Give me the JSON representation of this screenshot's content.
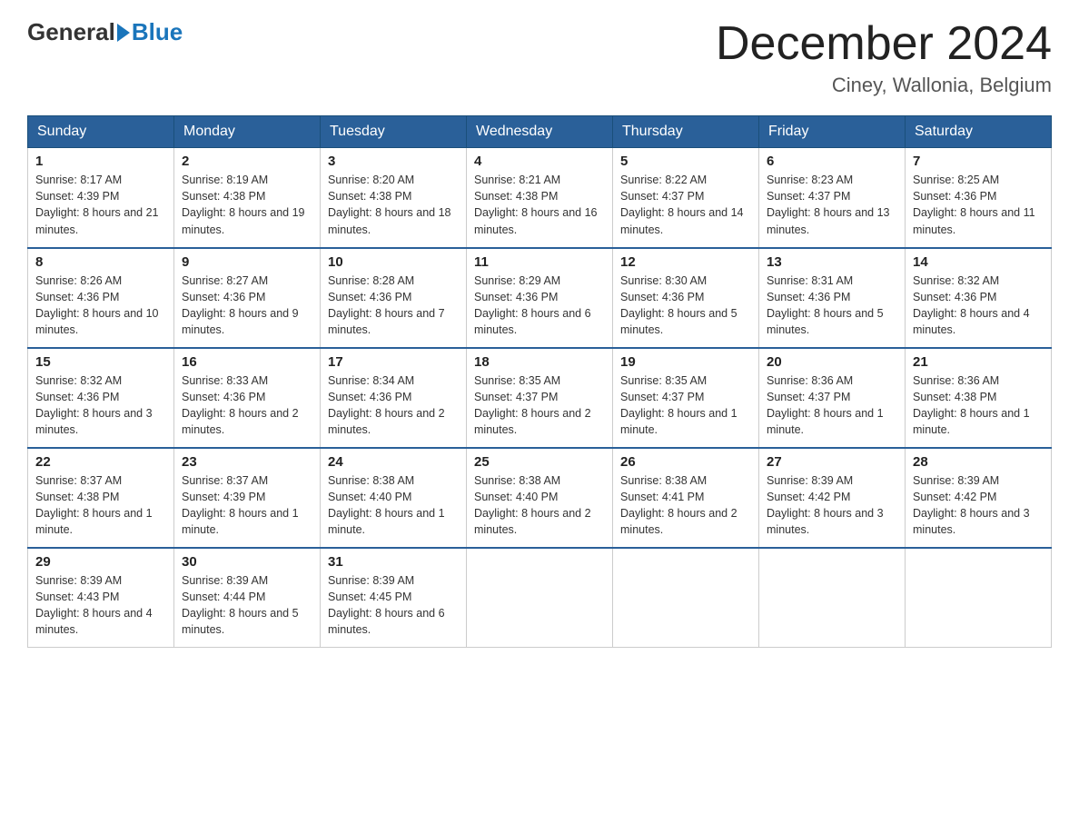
{
  "header": {
    "logo_general": "General",
    "logo_blue": "Blue",
    "month_title": "December 2024",
    "location": "Ciney, Wallonia, Belgium"
  },
  "weekdays": [
    "Sunday",
    "Monday",
    "Tuesday",
    "Wednesday",
    "Thursday",
    "Friday",
    "Saturday"
  ],
  "weeks": [
    [
      {
        "day": "1",
        "sunrise": "8:17 AM",
        "sunset": "4:39 PM",
        "daylight": "8 hours and 21 minutes."
      },
      {
        "day": "2",
        "sunrise": "8:19 AM",
        "sunset": "4:38 PM",
        "daylight": "8 hours and 19 minutes."
      },
      {
        "day": "3",
        "sunrise": "8:20 AM",
        "sunset": "4:38 PM",
        "daylight": "8 hours and 18 minutes."
      },
      {
        "day": "4",
        "sunrise": "8:21 AM",
        "sunset": "4:38 PM",
        "daylight": "8 hours and 16 minutes."
      },
      {
        "day": "5",
        "sunrise": "8:22 AM",
        "sunset": "4:37 PM",
        "daylight": "8 hours and 14 minutes."
      },
      {
        "day": "6",
        "sunrise": "8:23 AM",
        "sunset": "4:37 PM",
        "daylight": "8 hours and 13 minutes."
      },
      {
        "day": "7",
        "sunrise": "8:25 AM",
        "sunset": "4:36 PM",
        "daylight": "8 hours and 11 minutes."
      }
    ],
    [
      {
        "day": "8",
        "sunrise": "8:26 AM",
        "sunset": "4:36 PM",
        "daylight": "8 hours and 10 minutes."
      },
      {
        "day": "9",
        "sunrise": "8:27 AM",
        "sunset": "4:36 PM",
        "daylight": "8 hours and 9 minutes."
      },
      {
        "day": "10",
        "sunrise": "8:28 AM",
        "sunset": "4:36 PM",
        "daylight": "8 hours and 7 minutes."
      },
      {
        "day": "11",
        "sunrise": "8:29 AM",
        "sunset": "4:36 PM",
        "daylight": "8 hours and 6 minutes."
      },
      {
        "day": "12",
        "sunrise": "8:30 AM",
        "sunset": "4:36 PM",
        "daylight": "8 hours and 5 minutes."
      },
      {
        "day": "13",
        "sunrise": "8:31 AM",
        "sunset": "4:36 PM",
        "daylight": "8 hours and 5 minutes."
      },
      {
        "day": "14",
        "sunrise": "8:32 AM",
        "sunset": "4:36 PM",
        "daylight": "8 hours and 4 minutes."
      }
    ],
    [
      {
        "day": "15",
        "sunrise": "8:32 AM",
        "sunset": "4:36 PM",
        "daylight": "8 hours and 3 minutes."
      },
      {
        "day": "16",
        "sunrise": "8:33 AM",
        "sunset": "4:36 PM",
        "daylight": "8 hours and 2 minutes."
      },
      {
        "day": "17",
        "sunrise": "8:34 AM",
        "sunset": "4:36 PM",
        "daylight": "8 hours and 2 minutes."
      },
      {
        "day": "18",
        "sunrise": "8:35 AM",
        "sunset": "4:37 PM",
        "daylight": "8 hours and 2 minutes."
      },
      {
        "day": "19",
        "sunrise": "8:35 AM",
        "sunset": "4:37 PM",
        "daylight": "8 hours and 1 minute."
      },
      {
        "day": "20",
        "sunrise": "8:36 AM",
        "sunset": "4:37 PM",
        "daylight": "8 hours and 1 minute."
      },
      {
        "day": "21",
        "sunrise": "8:36 AM",
        "sunset": "4:38 PM",
        "daylight": "8 hours and 1 minute."
      }
    ],
    [
      {
        "day": "22",
        "sunrise": "8:37 AM",
        "sunset": "4:38 PM",
        "daylight": "8 hours and 1 minute."
      },
      {
        "day": "23",
        "sunrise": "8:37 AM",
        "sunset": "4:39 PM",
        "daylight": "8 hours and 1 minute."
      },
      {
        "day": "24",
        "sunrise": "8:38 AM",
        "sunset": "4:40 PM",
        "daylight": "8 hours and 1 minute."
      },
      {
        "day": "25",
        "sunrise": "8:38 AM",
        "sunset": "4:40 PM",
        "daylight": "8 hours and 2 minutes."
      },
      {
        "day": "26",
        "sunrise": "8:38 AM",
        "sunset": "4:41 PM",
        "daylight": "8 hours and 2 minutes."
      },
      {
        "day": "27",
        "sunrise": "8:39 AM",
        "sunset": "4:42 PM",
        "daylight": "8 hours and 3 minutes."
      },
      {
        "day": "28",
        "sunrise": "8:39 AM",
        "sunset": "4:42 PM",
        "daylight": "8 hours and 3 minutes."
      }
    ],
    [
      {
        "day": "29",
        "sunrise": "8:39 AM",
        "sunset": "4:43 PM",
        "daylight": "8 hours and 4 minutes."
      },
      {
        "day": "30",
        "sunrise": "8:39 AM",
        "sunset": "4:44 PM",
        "daylight": "8 hours and 5 minutes."
      },
      {
        "day": "31",
        "sunrise": "8:39 AM",
        "sunset": "4:45 PM",
        "daylight": "8 hours and 6 minutes."
      },
      null,
      null,
      null,
      null
    ]
  ],
  "labels": {
    "sunrise_prefix": "Sunrise: ",
    "sunset_prefix": "Sunset: ",
    "daylight_prefix": "Daylight: "
  }
}
